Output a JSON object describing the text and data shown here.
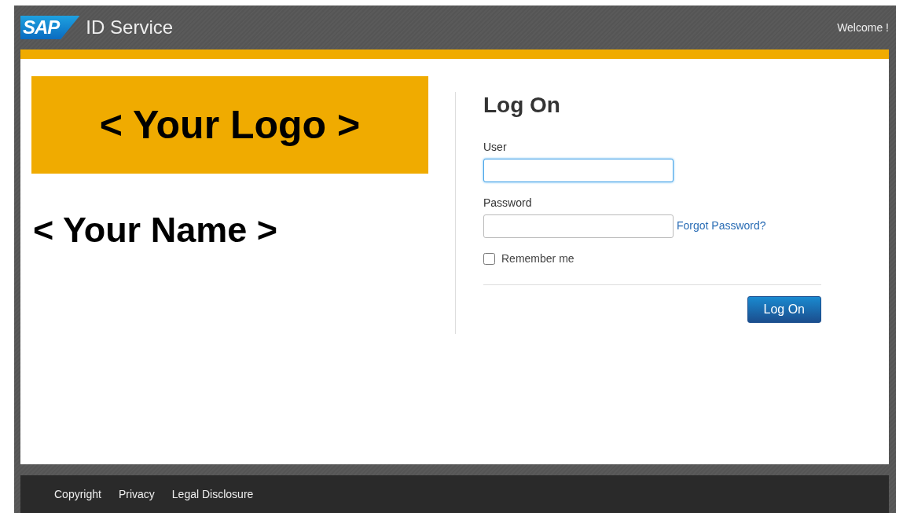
{
  "header": {
    "logo_text": "SAP",
    "title": "ID Service",
    "welcome": "Welcome !"
  },
  "branding": {
    "logo_placeholder": "< Your Logo >",
    "name_placeholder": "< Your Name >"
  },
  "login": {
    "heading": "Log On",
    "fields": [
      {
        "label": "User",
        "focused": true
      },
      {
        "label": "Password",
        "focused": false,
        "link": "Forgot Password?"
      }
    ],
    "remember": {
      "label": "Remember me",
      "checked": false
    },
    "submit": "Log On"
  },
  "footer": {
    "links": [
      "Copyright",
      "Privacy",
      "Legal Disclosure"
    ]
  }
}
